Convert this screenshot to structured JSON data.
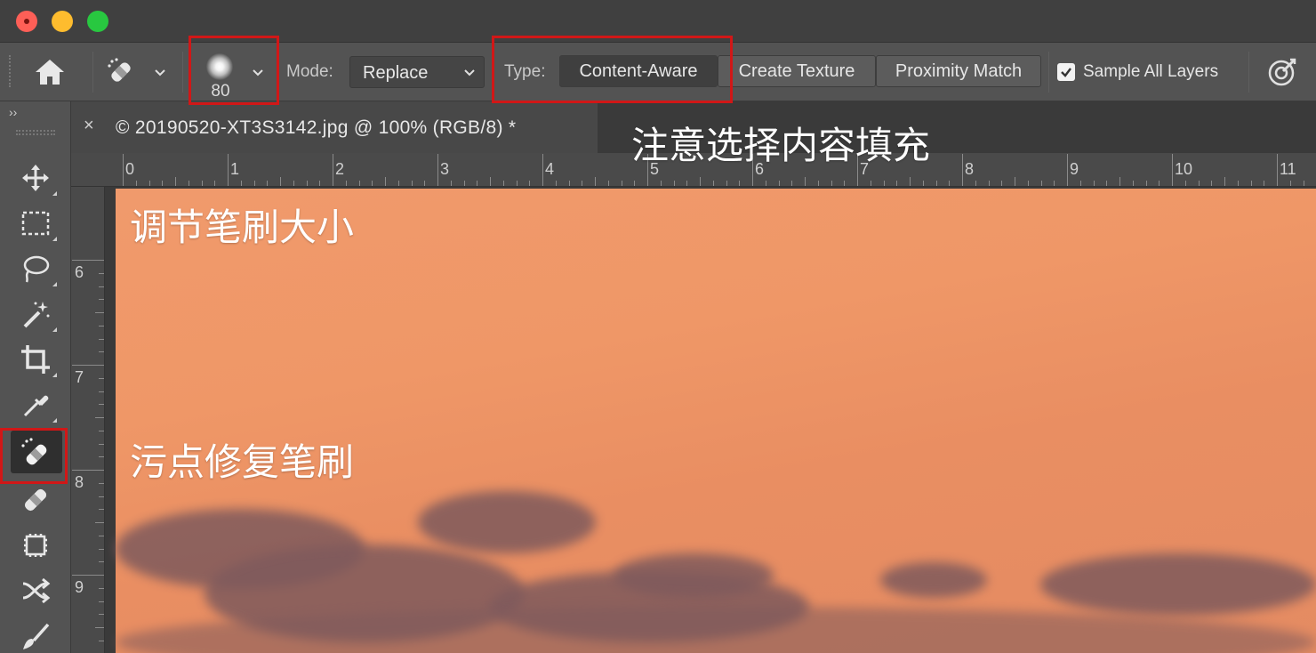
{
  "window": {
    "traffic_lights": [
      "close",
      "minimize",
      "zoom"
    ]
  },
  "options_bar": {
    "brush_size": "80",
    "mode_label": "Mode:",
    "mode_value": "Replace",
    "type_label": "Type:",
    "type_options": [
      {
        "label": "Content-Aware",
        "selected": true
      },
      {
        "label": "Create Texture",
        "selected": false
      },
      {
        "label": "Proximity Match",
        "selected": false
      }
    ],
    "sample_all_layers_label": "Sample All Layers",
    "sample_all_layers_checked": true
  },
  "toolbar": {
    "collapse_glyph": "››",
    "tools": [
      {
        "name": "move-tool",
        "icon": "move-icon"
      },
      {
        "name": "marquee-tool",
        "icon": "rect-marquee-icon"
      },
      {
        "name": "lasso-tool",
        "icon": "lasso-icon"
      },
      {
        "name": "magic-wand-tool",
        "icon": "magic-wand-icon"
      },
      {
        "name": "crop-tool",
        "icon": "crop-icon"
      },
      {
        "name": "eyedropper-tool",
        "icon": "eyedropper-icon"
      },
      {
        "name": "spot-healing-brush-tool",
        "icon": "spot-healing-icon",
        "selected": true
      },
      {
        "name": "healing-brush-tool",
        "icon": "bandage-icon"
      },
      {
        "name": "patch-tool",
        "icon": "patch-icon"
      },
      {
        "name": "content-aware-move-tool",
        "icon": "crossing-arrows-icon"
      },
      {
        "name": "brush-tool",
        "icon": "brush-icon"
      }
    ]
  },
  "document": {
    "tab_close": "×",
    "tab_title": "© 20190520-XT3S3142.jpg @ 100% (RGB/8) *"
  },
  "rulers": {
    "horizontal": [
      "0",
      "1",
      "2",
      "3",
      "4",
      "5",
      "6",
      "7",
      "8",
      "9",
      "10",
      "11"
    ],
    "vertical": [
      "6",
      "7",
      "8",
      "9"
    ]
  },
  "annotations": {
    "content_fill_note": "注意选择内容填充",
    "brush_size_note": "调节笔刷大小",
    "spot_healing_note": "污点修复笔刷"
  },
  "colors": {
    "annotation_red": "#d11717",
    "sky_orange": "#ef9767",
    "cloud_purple": "#7f5a5c"
  }
}
